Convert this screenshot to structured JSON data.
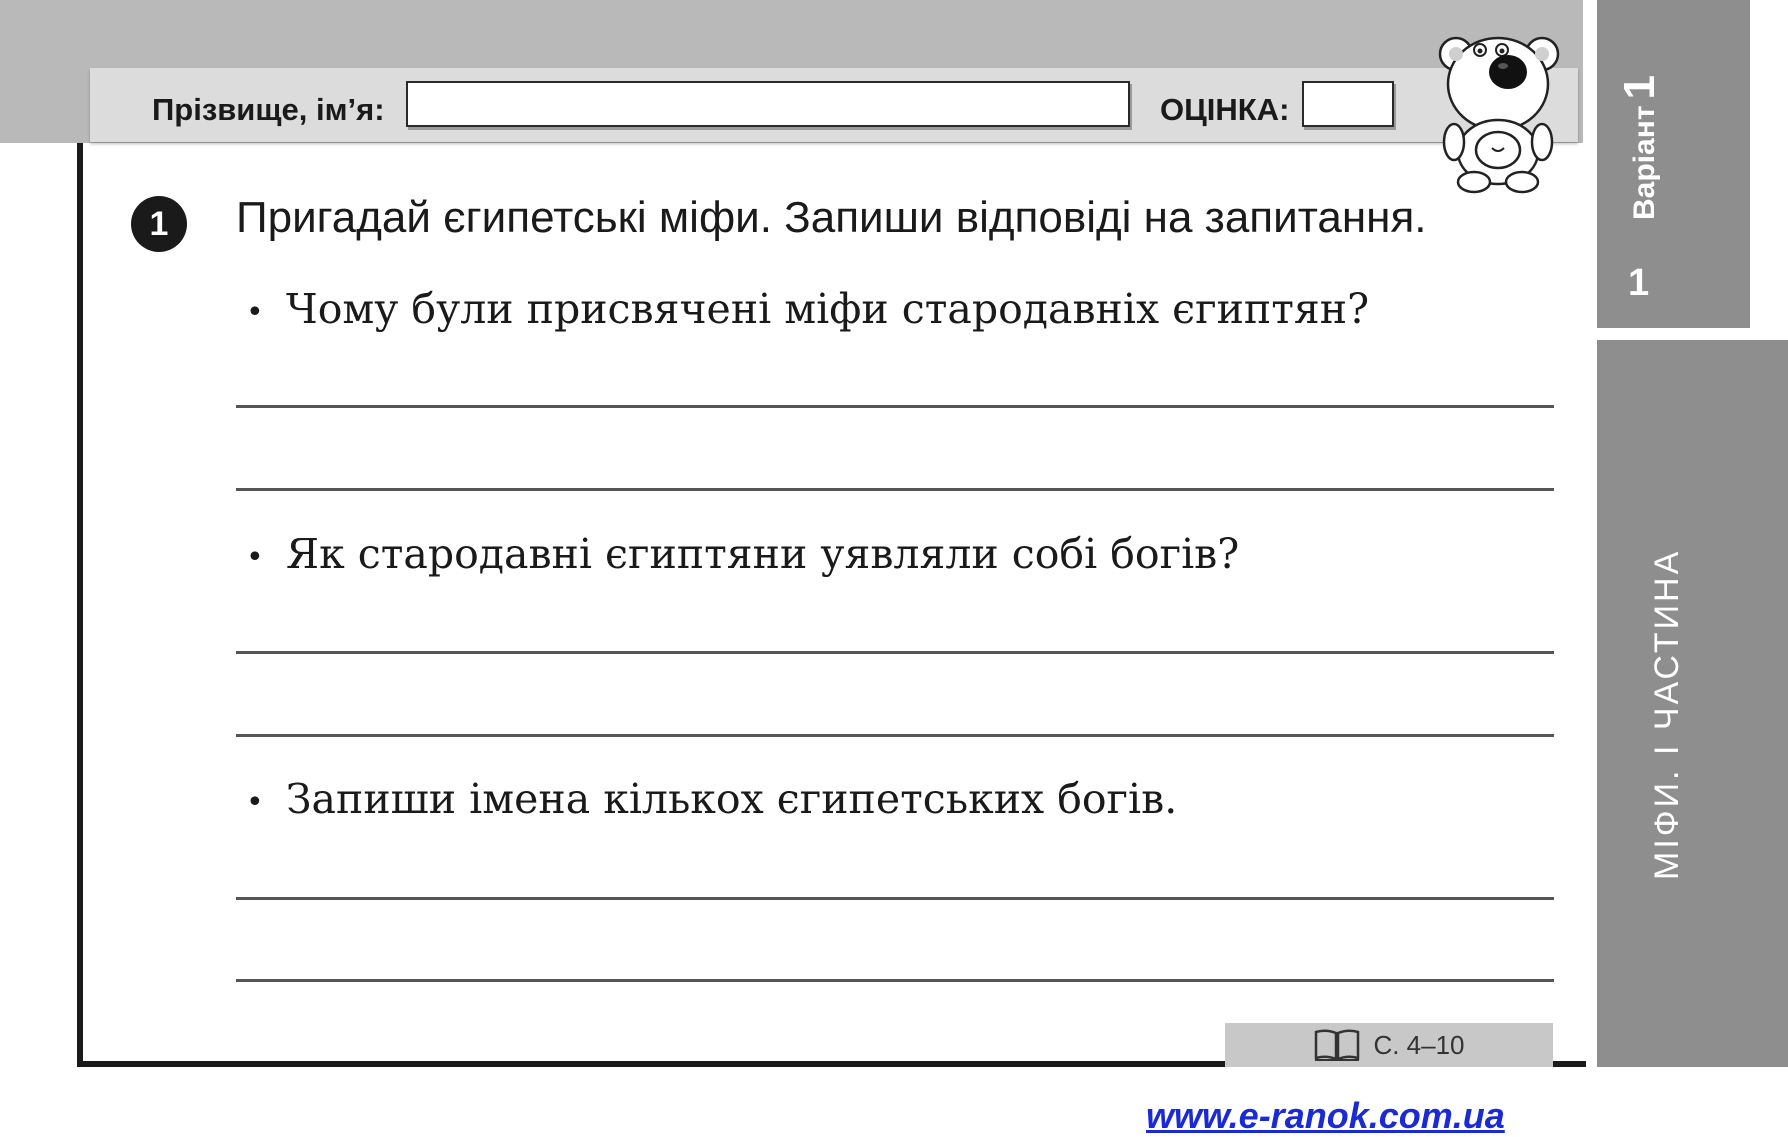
{
  "header": {
    "name_label": "Прізвище, ім’я:",
    "grade_label": "ОЦІНКА:",
    "name_value": "",
    "grade_value": ""
  },
  "sidebar": {
    "variant_label": "Варіант",
    "variant_number": "1",
    "part_number": "1",
    "section_title": "МІФИ. І ЧАСТИНА"
  },
  "task": {
    "number": "1",
    "title": "Пригадай єгипетські міфи. Запиши відповіді на запитання.",
    "questions": [
      {
        "bullet": "•",
        "text": "Чому були присвячені міфи стародавніх єгиптян?"
      },
      {
        "bullet": "•",
        "text": "Як стародавні єгиптяни уявляли собі богів?"
      },
      {
        "bullet": "•",
        "text": "Запиши імена кількох єгипетських богів."
      }
    ]
  },
  "reference": {
    "icon": "book-icon",
    "text": "С. 4–10"
  },
  "footer": {
    "link": "www.e-ranok.com.ua"
  },
  "mascot": {
    "icon": "bear-mascot-icon"
  }
}
